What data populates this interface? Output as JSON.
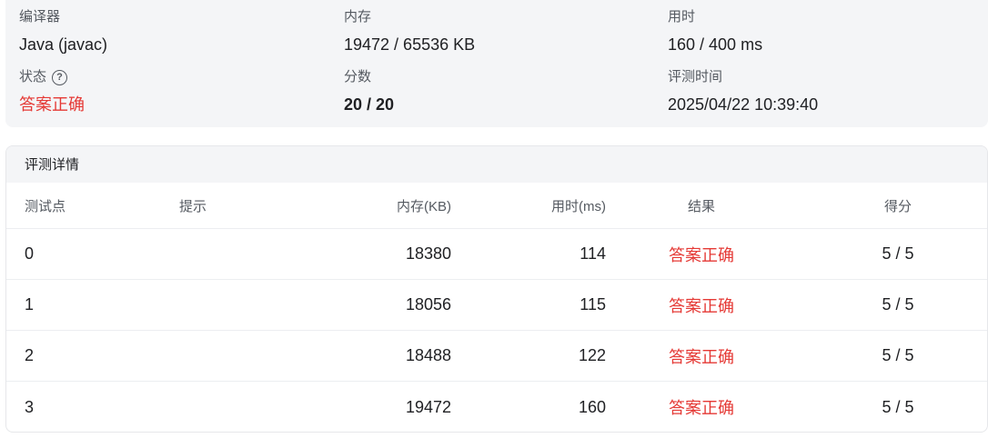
{
  "summary": {
    "compiler_label": "编译器",
    "compiler_value": "Java (javac)",
    "memory_label": "内存",
    "memory_value": "19472 / 65536 KB",
    "time_label": "用时",
    "time_value": "160 / 400 ms",
    "status_label": "状态",
    "status_value": "答案正确",
    "score_label": "分数",
    "score_value": "20 / 20",
    "judge_time_label": "评测时间",
    "judge_time_value": "2025/04/22 10:39:40",
    "help_icon_glyph": "?",
    "status_color": "#e53935"
  },
  "details": {
    "title": "评测详情",
    "headers": {
      "id": "测试点",
      "hint": "提示",
      "memory": "内存(KB)",
      "time": "用时(ms)",
      "result": "结果",
      "score": "得分"
    },
    "rows": [
      {
        "id": "0",
        "hint": "",
        "memory": "18380",
        "time": "114",
        "result": "答案正确",
        "score": "5 / 5"
      },
      {
        "id": "1",
        "hint": "",
        "memory": "18056",
        "time": "115",
        "result": "答案正确",
        "score": "5 / 5"
      },
      {
        "id": "2",
        "hint": "",
        "memory": "18488",
        "time": "122",
        "result": "答案正确",
        "score": "5 / 5"
      },
      {
        "id": "3",
        "hint": "",
        "memory": "19472",
        "time": "160",
        "result": "答案正确",
        "score": "5 / 5"
      }
    ]
  }
}
